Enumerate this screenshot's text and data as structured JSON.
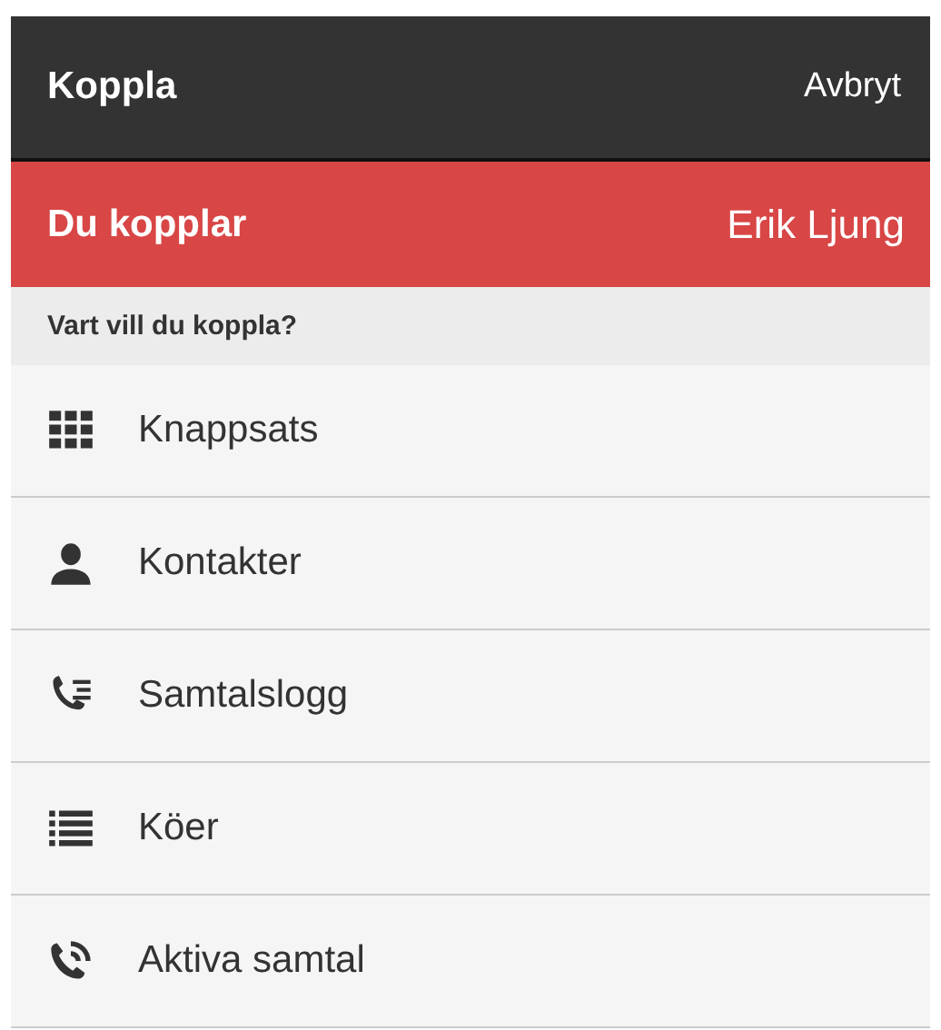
{
  "app_bar": {
    "title": "Koppla",
    "action": "Avbryt"
  },
  "transfer_banner": {
    "label": "Du kopplar",
    "name": "Erik Ljung"
  },
  "section_header": "Vart vill du koppla?",
  "options": [
    {
      "kind": "keypad",
      "label": "Knappsats"
    },
    {
      "kind": "person",
      "label": "Kontakter"
    },
    {
      "kind": "call-log",
      "label": "Samtalslogg"
    },
    {
      "kind": "queue",
      "label": "Köer"
    },
    {
      "kind": "active-call",
      "label": "Aktiva samtal"
    }
  ]
}
